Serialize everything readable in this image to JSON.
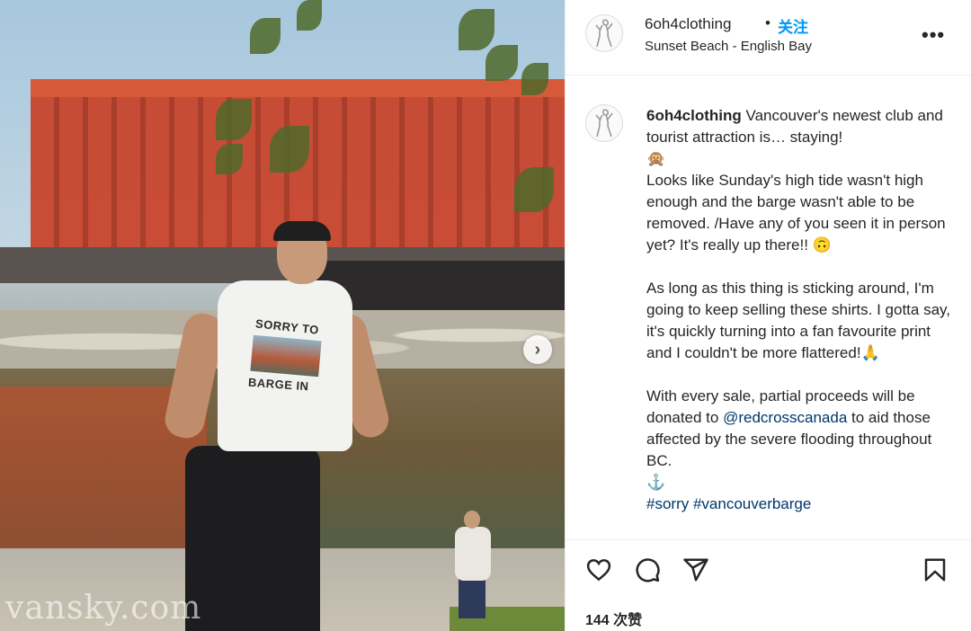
{
  "post": {
    "username": "6oh4clothing",
    "separator": "•",
    "follow_label": "关注",
    "location": "Sunset Beach - English Bay",
    "more_label": "•••",
    "next_label": "›",
    "watermark": "vansky.com",
    "shirt_print": {
      "line1": "SORRY TO",
      "line2": "BARGE IN"
    }
  },
  "caption": {
    "username": "6oh4clothing",
    "lines": [
      "Vancouver's newest club and tourist attraction is… staying!",
      "🙊",
      "Looks like Sunday's high tide wasn't high enough and the barge wasn't able to be removed. /Have any of you seen it in person yet? It's really up there!! 🙃",
      "As long as this thing is sticking around, I'm going to keep selling these shirts. I gotta say, it's quickly turning into a fan favourite print and I couldn't be more flattered!🙏"
    ],
    "sale_before": "With every sale, partial proceeds will be donated to ",
    "mention": "@redcrosscanada",
    "sale_after": " to aid those affected by the severe flooding throughout BC.",
    "anchor": "⚓",
    "hashtag1": "#sorry",
    "hashtag2": "#vancouverbarge"
  },
  "actions": {
    "likes_text": "144 次赞",
    "icons": [
      "heart-icon",
      "comment-icon",
      "share-icon",
      "bookmark-icon"
    ]
  },
  "colors": {
    "accent": "#0095f6",
    "link": "#00376b",
    "text": "#262626",
    "border": "#efefef"
  }
}
